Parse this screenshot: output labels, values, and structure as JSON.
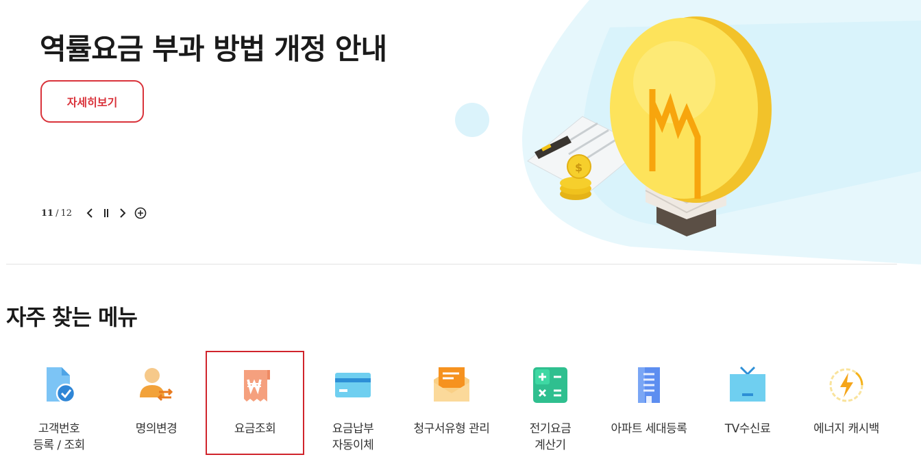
{
  "banner": {
    "title": "역률요금 부과 방법 개정 안내",
    "detail_button": "자세히보기",
    "pager": {
      "current": "11",
      "separator": "/",
      "total": "12"
    }
  },
  "quick_menu": {
    "title": "자주 찾는 메뉴",
    "selected_index": 2,
    "items": [
      {
        "label": "고객번호\n등록 / 조회",
        "icon": "customer-document-check-icon"
      },
      {
        "label": "명의변경",
        "icon": "user-transfer-icon"
      },
      {
        "label": "요금조회",
        "icon": "won-receipt-icon"
      },
      {
        "label": "요금납부\n자동이체",
        "icon": "credit-card-icon"
      },
      {
        "label": "청구서유형 관리",
        "icon": "envelope-bill-icon"
      },
      {
        "label": "전기요금\n계산기",
        "icon": "calculator-icon"
      },
      {
        "label": "아파트 세대등록",
        "icon": "apartment-building-icon"
      },
      {
        "label": "TV수신료",
        "icon": "tv-icon"
      },
      {
        "label": "에너지 캐시백",
        "icon": "energy-cashback-icon"
      }
    ]
  },
  "colors": {
    "accent_red": "#d9323a",
    "selected_border": "#d0232b",
    "text": "#1a1a1a"
  }
}
